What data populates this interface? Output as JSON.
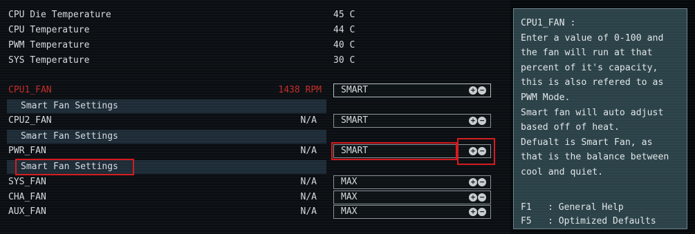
{
  "temperatures": [
    {
      "label": "CPU Die Temperature",
      "value": "45 C"
    },
    {
      "label": "CPU Temperature",
      "value": "44 C"
    },
    {
      "label": "PWM Temperature",
      "value": "40 C"
    },
    {
      "label": "SYS Temperature",
      "value": "30 C"
    }
  ],
  "fans": {
    "cpu1": {
      "label": "CPU1_FAN",
      "speed": "1438 RPM",
      "mode": "SMART",
      "settings_label": "Smart Fan Settings"
    },
    "cpu2": {
      "label": "CPU2_FAN",
      "speed": "N/A",
      "mode": "SMART",
      "settings_label": "Smart Fan Settings"
    },
    "pwr": {
      "label": "PWR_FAN",
      "speed": "N/A",
      "mode": "SMART",
      "settings_label": "Smart Fan Settings"
    },
    "sys": {
      "label": "SYS_FAN",
      "speed": "N/A",
      "mode": "MAX"
    },
    "cha": {
      "label": "CHA_FAN",
      "speed": "N/A",
      "mode": "MAX"
    },
    "aux": {
      "label": "AUX_FAN",
      "speed": "N/A",
      "mode": "MAX"
    }
  },
  "buttons": {
    "increase": "+",
    "decrease": "−"
  },
  "help": {
    "lines": [
      "CPU1_FAN :",
      "Enter a value of 0-100 and",
      "the fan will run at that",
      "percent of it's capacity,",
      "this is also refered to as",
      "PWM Mode.",
      "Smart fan will auto adjust",
      "based off of heat.",
      "Defualt is Smart Fan, as",
      "that is the balance between",
      "cool and quiet."
    ],
    "keys": [
      {
        "key": "F1",
        "desc": ": General Help"
      },
      {
        "key": "F5",
        "desc": ": Optimized Defaults"
      }
    ]
  },
  "colors": {
    "selected_text": "#c42a26",
    "highlight_box": "#d8181c",
    "help_bg": "#2a4147"
  }
}
